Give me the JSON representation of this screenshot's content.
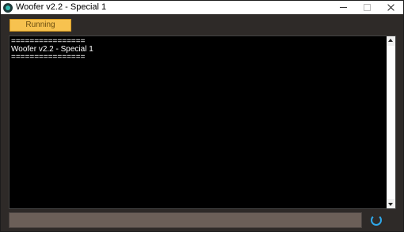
{
  "window": {
    "title": "Woofer v2.2 - Special 1",
    "app_icon": "woofer-logo-icon",
    "controls": [
      "minimize-icon",
      "maximize-icon",
      "close-icon"
    ]
  },
  "toolbar": {
    "status_label": "Running",
    "status_color": "#f7c24f"
  },
  "console": {
    "text": "================\nWoofer v2.2 - Special 1\n================",
    "background": "#000000"
  },
  "command_input": {
    "value": ""
  },
  "spinner": {
    "icon": "loading-spinner-icon",
    "color": "#2fa7e8"
  }
}
